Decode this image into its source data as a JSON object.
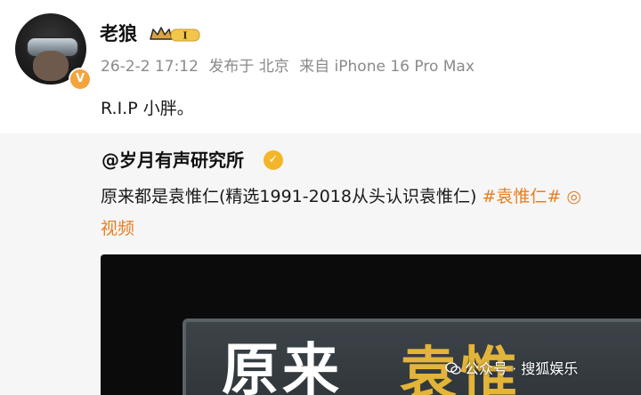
{
  "post": {
    "username": "老狼",
    "vip_level": "I",
    "meta": {
      "time": "26-2-2 17:12",
      "location": "发布于 北京",
      "source": "来自 iPhone 16 Pro Max"
    },
    "content": "R.I.P 小胖。"
  },
  "repost": {
    "author": "@岁月有声研究所",
    "text": "原来都是袁惟仁(精选1991-2018从头认识袁惟仁)",
    "hashtag": "#袁惟仁#",
    "link_tail": "视频",
    "video_title_white": "原来",
    "video_title_gold": "袁惟"
  },
  "watermark": "公众号 · 搜狐娱乐",
  "colors": {
    "accent_orange": "#e67e22",
    "verify_gold": "#f3b52a",
    "meta_gray": "#8a8a8a"
  }
}
